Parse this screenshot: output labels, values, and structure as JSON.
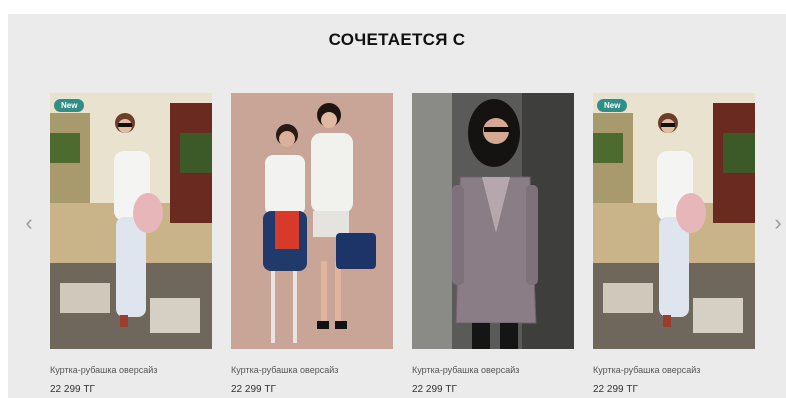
{
  "section": {
    "title": "СОЧЕТАЕТСЯ С"
  },
  "carousel": {
    "prev_icon": "chevron-left-icon",
    "next_icon": "chevron-right-icon",
    "products": [
      {
        "badge": "New",
        "name": "Куртка-рубашка оверсайз",
        "price": "22 299 ТГ"
      },
      {
        "badge": "",
        "name": "Куртка-рубашка оверсайз",
        "price": "22 299 ТГ"
      },
      {
        "badge": "",
        "name": "Куртка-рубашка оверсайз",
        "price": "22 299 ТГ"
      },
      {
        "badge": "New",
        "name": "Куртка-рубашка оверсайз",
        "price": "22 299 ТГ"
      }
    ]
  },
  "colors": {
    "panel": "#ebebeb",
    "badge": "#2f8f86"
  }
}
